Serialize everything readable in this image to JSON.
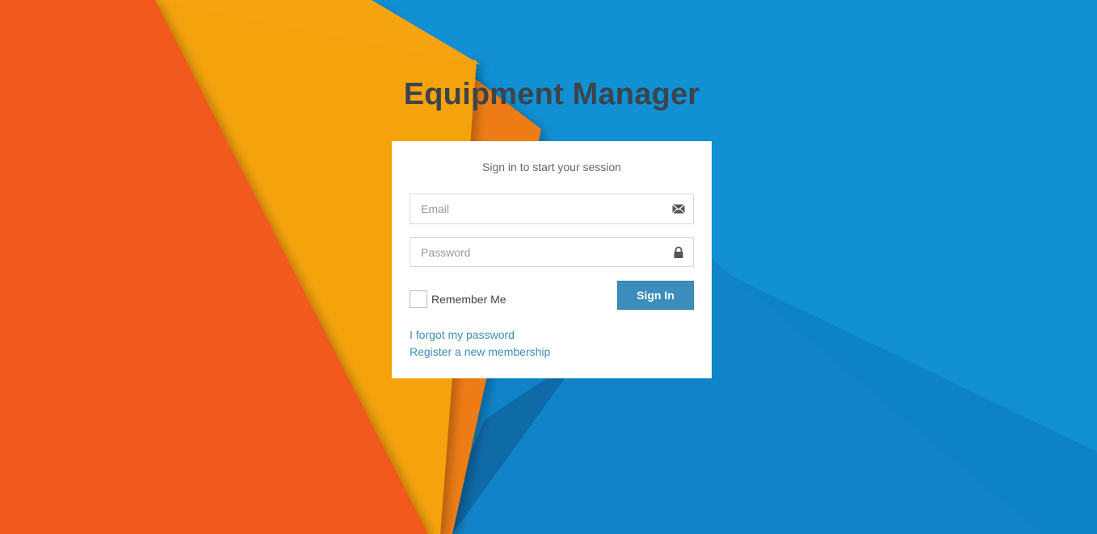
{
  "app": {
    "title": "Equipment Manager"
  },
  "login": {
    "message": "Sign in to start your session",
    "email_placeholder": "Email",
    "email_value": "",
    "password_placeholder": "Password",
    "password_value": "",
    "remember_label": "Remember Me",
    "remember_checked": false,
    "signin_label": "Sign In",
    "forgot_link": "I forgot my password",
    "register_link": "Register a new membership"
  },
  "icons": {
    "email": "envelope-icon",
    "password": "lock-icon"
  },
  "colors": {
    "primary": "#3c8dbc",
    "title": "#3c444b",
    "background_blue": "#1190d4",
    "background_orange": "#f15a1c",
    "background_yellow": "#f5a311"
  }
}
